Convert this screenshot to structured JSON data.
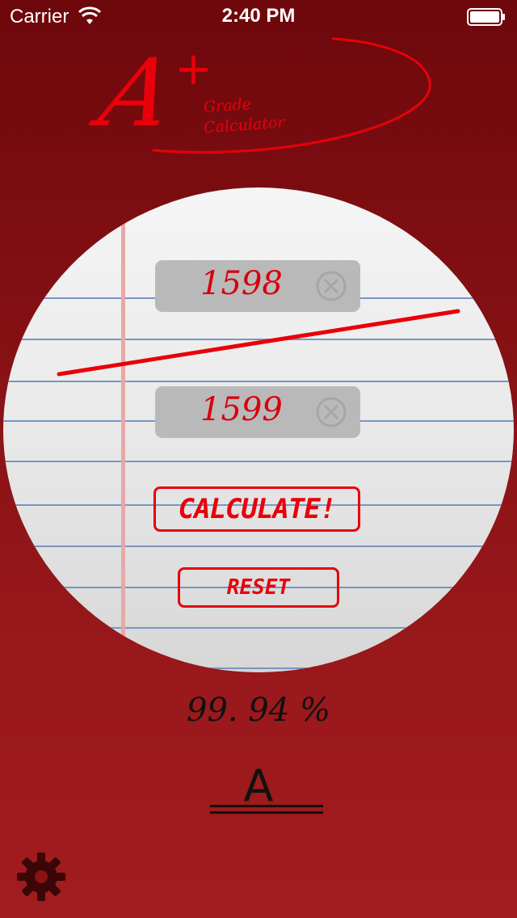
{
  "status_bar": {
    "carrier": "Carrier",
    "time": "2:40 PM",
    "wifi_icon": "wifi-icon",
    "battery_icon": "battery-icon"
  },
  "logo": {
    "letter": "A",
    "plus": "+",
    "line1": "Grade",
    "line2": "Calculator"
  },
  "inputs": {
    "points_earned": "1598",
    "points_possible": "1599",
    "clear_icon": "clear-circle-x-icon"
  },
  "buttons": {
    "calculate": "CALCULATE!",
    "reset": "RESET"
  },
  "result": {
    "percent": "99. 94 %",
    "letter_grade": "A"
  },
  "settings": {
    "icon": "gear-icon"
  },
  "colors": {
    "accent_red": "#e8000a",
    "background_dark": "#6d080c",
    "background_light": "#a11c1e",
    "field_gray": "#b9b9b9",
    "rule_blue": "#7895c3",
    "margin_pink": "#e9a7a7"
  }
}
